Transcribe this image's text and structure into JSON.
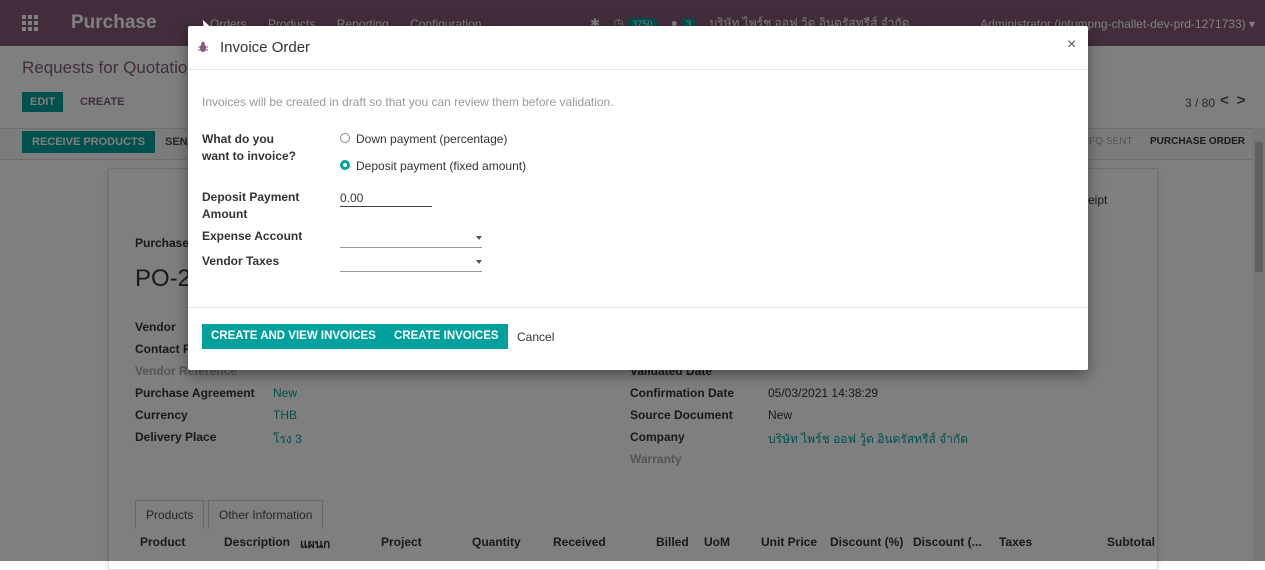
{
  "navbar": {
    "brand": "Purchase",
    "menu": [
      "Orders",
      "Products",
      "Reporting",
      "Configuration"
    ],
    "badge_activity": "3750",
    "badge_messages": "3",
    "company": "บริษัท ไพร์ช ออฟ วู้ด อินดรัสทรีส์ จำกัด",
    "user": "Administrator (intumpng-challet-dev-prd-1271733)"
  },
  "control": {
    "breadcrumb": "Requests for Quotation",
    "edit_label": "EDIT",
    "create_label": "CREATE",
    "pager": "3 / 80",
    "prev_glyph": "<",
    "next_glyph": ">"
  },
  "statusbar": {
    "receive_label": "RECEIVE PRODUCTS",
    "send_label": "SEN",
    "stage_sent": "RFQ SENT",
    "stage_po": "PURCHASE ORDER"
  },
  "form": {
    "receipt_label": "eipt",
    "purchase_label": "Purchase",
    "po_number": "PO-2",
    "vendor_label": "Vendor",
    "contact_label": "Contact P",
    "vendor_ref_label": "Vendor Reference",
    "agreement_label": "Purchase Agreement",
    "agreement_value": "New",
    "currency_label": "Currency",
    "currency_value": "THB",
    "delivery_label": "Delivery Place",
    "delivery_value": "โรง 3",
    "validated_label": "Validated Date",
    "confirm_label": "Confirmation Date",
    "confirm_value": "05/03/2021 14:38:29",
    "source_label": "Source Document",
    "source_value": "New",
    "company_label": "Company",
    "company_value": "บริษัท ไพร์ช ออฟ วู้ด อินดรัสทรีส์ จำกัด",
    "warranty_label": "Warranty",
    "tabs": [
      "Products",
      "Other Information"
    ],
    "columns": [
      "Product",
      "Description",
      "แผนก",
      "Project",
      "Quantity",
      "Received",
      "Billed",
      "UoM",
      "Unit Price",
      "Discount (%)",
      "Discount (...",
      "Taxes",
      "Subtotal"
    ]
  },
  "dialog": {
    "title": "Invoice Order",
    "close_glyph": "×",
    "hint": "Invoices will be created in draft so that you can review them before validation.",
    "question_label": "What do you want to invoice?",
    "options": [
      "Down payment (percentage)",
      "Deposit payment (fixed amount)"
    ],
    "selected_option": "Deposit payment (fixed amount)",
    "deposit_label": "Deposit Payment Amount",
    "deposit_value": "0.00",
    "expense_label": "Expense Account",
    "expense_value": "",
    "taxes_label": "Vendor Taxes",
    "taxes_value": "",
    "btn_create_view": "CREATE AND VIEW INVOICES",
    "btn_create": "CREATE INVOICES",
    "btn_cancel": "Cancel"
  },
  "colors": {
    "brand": "#875a7b",
    "accent": "#00a09d"
  }
}
